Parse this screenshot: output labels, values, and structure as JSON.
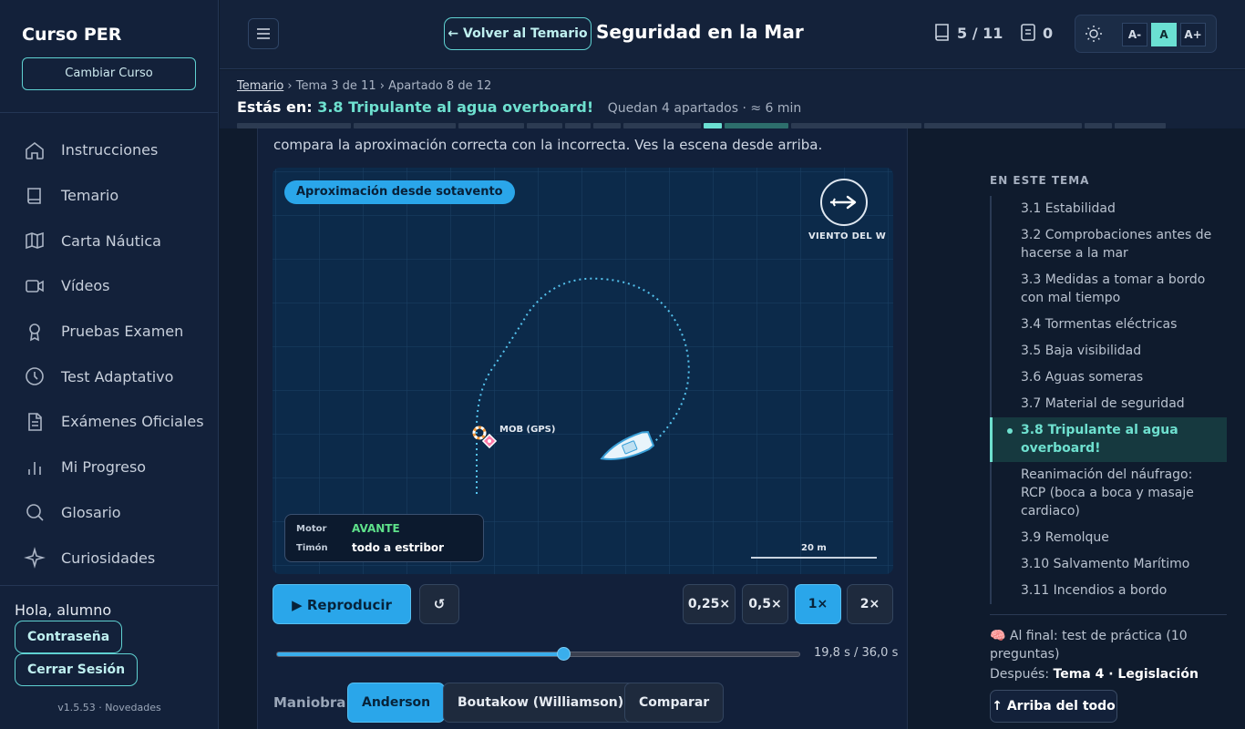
{
  "sidebar": {
    "brand": "Curso PER",
    "change_course": "Cambiar Curso",
    "items": [
      {
        "label": "Instrucciones",
        "icon": "home-icon"
      },
      {
        "label": "Temario",
        "icon": "book-icon"
      },
      {
        "label": "Carta Náutica",
        "icon": "map-icon"
      },
      {
        "label": "Vídeos",
        "icon": "video-icon"
      },
      {
        "label": "Pruebas Examen",
        "icon": "award-icon"
      },
      {
        "label": "Test Adaptativo",
        "icon": "clock-icon"
      },
      {
        "label": "Exámenes Oficiales",
        "icon": "document-icon"
      },
      {
        "label": "Mi Progreso",
        "icon": "bar-chart-icon"
      },
      {
        "label": "Glosario",
        "icon": "search-icon"
      },
      {
        "label": "Curiosidades",
        "icon": "sparkle-icon"
      }
    ],
    "greeting": "Hola, alumno",
    "password_btn": "Contraseña",
    "logout_btn": "Cerrar Sesión",
    "version": "v1.5.53 · Novedades"
  },
  "header": {
    "back_btn": "← Volver al Temario",
    "title": "Seguridad en la Mar",
    "book_count": "5 / 11",
    "notes_count": "0",
    "font_small": "A-",
    "font_normal": "A",
    "font_large": "A+"
  },
  "subheader": {
    "crumb_root": "Temario",
    "crumb_tema": "Tema 3 de 11",
    "crumb_apartado": "Apartado 8 de 12",
    "estas_prefix": "Estás en:",
    "estas_current": "3.8 Tripulante al agua overboard!",
    "quedan": "Quedan 4 apartados · ≈ 6 min"
  },
  "main": {
    "intro": "compara la aproximación correcta con la incorrecta. Ves la escena desde arriba.",
    "scene_tag": "Aproximación desde sotavento",
    "wind_label": "VIENTO DEL W",
    "mob_label": "MOB (GPS)",
    "hud": {
      "motor_key": "Motor",
      "motor_val": "AVANTE",
      "timon_key": "Timón",
      "timon_val": "todo a estribor"
    },
    "scale_label": "20 m",
    "play_btn": "▶ Reproducir",
    "reset_btn": "↺",
    "speeds": [
      "0,25×",
      "0,5×",
      "1×",
      "2×"
    ],
    "active_speed": "1×",
    "progress_fraction": 0.55,
    "time": "19,8 s / 36,0 s",
    "maniobra_label": "Maniobra",
    "maniobras": [
      "Anderson",
      "Boutakow (Williamson)",
      "Comparar"
    ],
    "active_maniobra": "Anderson"
  },
  "toc": {
    "heading": "EN ESTE TEMA",
    "items": [
      "3.1 Estabilidad",
      "3.2 Comprobaciones antes de hacerse a la mar",
      "3.3 Medidas a tomar a bordo con mal tiempo",
      "3.4 Tormentas eléctricas",
      "3.5 Baja visibilidad",
      "3.6 Aguas someras",
      "3.7 Material de seguridad",
      "3.8 Tripulante al agua overboard!",
      "Reanimación del náufrago: RCP (boca a boca y masaje cardiaco)",
      "3.9 Remolque",
      "3.10 Salvamento Marítimo",
      "3.11 Incendios a bordo"
    ],
    "active_index": 7,
    "final_text": "🧠 Al final: test de práctica (10 preguntas)",
    "despues_prefix": "Después:",
    "despues_value": "Tema 4 · Legislación",
    "arriba_btn": "↑ Arriba del todo"
  },
  "colors": {
    "accent": "#6be0d3",
    "primary": "#2aa6ea",
    "background": "#0f1b2d",
    "motor_status": "#5ee08a"
  }
}
